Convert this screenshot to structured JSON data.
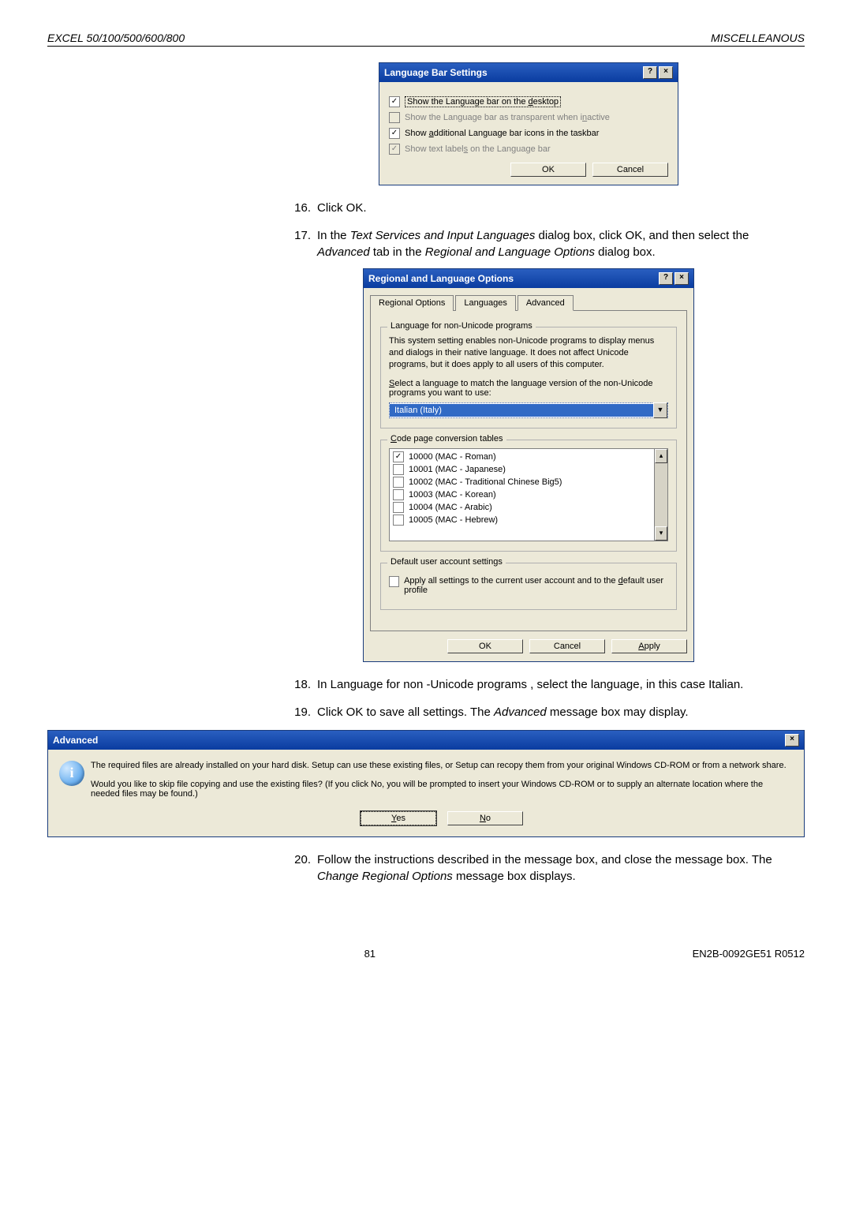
{
  "header": {
    "left": "EXCEL 50/100/500/600/800",
    "right": "MISCELLEANOUS"
  },
  "langbar": {
    "title": "Language Bar Settings",
    "help_btn": "?",
    "close_btn": "×",
    "opt1": "Show the Language bar on the desktop",
    "opt2": "Show the Language bar as transparent when inactive",
    "opt3": "Show additional Language bar icons in the taskbar",
    "opt4": "Show text labels on the Language bar",
    "ok": "OK",
    "cancel": "Cancel"
  },
  "steps": {
    "s16n": "16.",
    "s16": "Click OK.",
    "s17n": "17.",
    "s17a": "In the ",
    "s17b": "Text Services and Input Languages",
    "s17c": " dialog box, click OK, and then select the ",
    "s17d": "Advanced",
    "s17e": " tab in the ",
    "s17f": "Regional and Language Options",
    "s17g": " dialog box.",
    "s18n": "18.",
    "s18": "In Language for non  -Unicode programs  , select the language, in this case Italian.",
    "s19n": "19.",
    "s19a": "Click OK to save all settings. The ",
    "s19b": "Advanced",
    "s19c": " message box may display.",
    "s20n": "20.",
    "s20a": "Follow the instructions described in the message box, and close the message box. The ",
    "s20b": "Change Regional Options",
    "s20c": " message box displays."
  },
  "regional": {
    "title": "Regional and Language Options",
    "help_btn": "?",
    "close_btn": "×",
    "tab1": "Regional Options",
    "tab2": "Languages",
    "tab3": "Advanced",
    "group1": "Language for non-Unicode programs",
    "desc1": "This system setting enables non-Unicode programs to display menus and dialogs in their native language. It does not affect Unicode programs, but it does apply to all users of this computer.",
    "desc2_a": "Select a language to match the language version of the non-Unicode programs you want to use:",
    "select_val": "Italian (Italy)",
    "group2": "Code page conversion tables",
    "items": [
      {
        "label": "10000 (MAC - Roman)",
        "checked": true
      },
      {
        "label": "10001 (MAC - Japanese)",
        "checked": false
      },
      {
        "label": "10002 (MAC - Traditional Chinese Big5)",
        "checked": false
      },
      {
        "label": "10003 (MAC - Korean)",
        "checked": false
      },
      {
        "label": "10004 (MAC - Arabic)",
        "checked": false
      },
      {
        "label": "10005 (MAC - Hebrew)",
        "checked": false
      }
    ],
    "group3": "Default user account settings",
    "default_chk": "Apply all settings to the current user account and to the default user profile",
    "ok": "OK",
    "cancel": "Cancel",
    "apply": "Apply"
  },
  "advmsg": {
    "title": "Advanced",
    "close_btn": "×",
    "line1": "The required files are already installed on your hard disk. Setup can use these existing files, or Setup can recopy them from your original Windows CD-ROM or from a network share.",
    "line2": "Would you like to skip file copying and use the existing files? (If you click No, you will be prompted to insert your Windows CD-ROM or to supply an alternate location where the needed files may be found.)",
    "yes": "Yes",
    "no": "No"
  },
  "footer": {
    "page": "81",
    "code": "EN2B-0092GE51 R0512"
  }
}
